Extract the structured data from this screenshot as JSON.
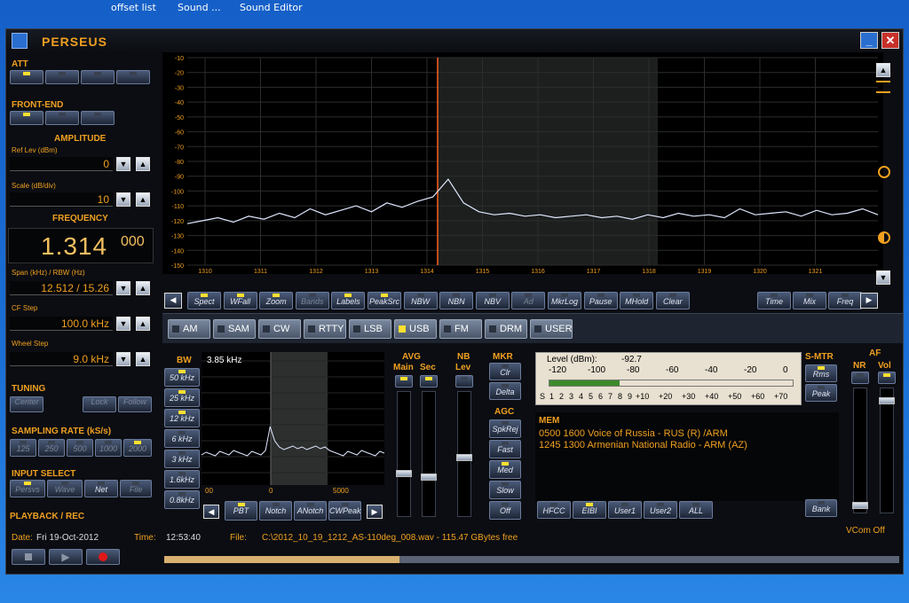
{
  "desktop": {
    "labels": [
      "offset list",
      "Sound ...",
      "Sound Editor"
    ]
  },
  "window": {
    "title": "PERSEUS",
    "minimize": "_",
    "close": "✕"
  },
  "left": {
    "att": "ATT",
    "frontend": "FRONT-END",
    "amplitude": "AMPLITUDE",
    "ref_lev_label": "Ref Lev (dBm)",
    "ref_lev": "0",
    "scale_label": "Scale (dB/div)",
    "scale": "10",
    "frequency": "FREQUENCY",
    "freq_main": "1.314",
    "freq_small": "000",
    "span_label": "Span (kHz) / RBW (Hz)",
    "span": "12.512 / 15.26",
    "cf_step_label": "CF Step",
    "cf_step": "100.0 kHz",
    "wheel_label": "Wheel Step",
    "wheel": "9.0 kHz",
    "tuning": "TUNING",
    "tuning_btns": [
      "Center",
      "Lock",
      "Follow"
    ],
    "sampling": "SAMPLING RATE (kS/s)",
    "sampling_btns": [
      "125",
      "250",
      "500",
      "1000",
      "2000"
    ],
    "input": "INPUT SELECT",
    "input_btns": [
      "Persvs",
      "Wave",
      "Net",
      "File"
    ],
    "playback": "PLAYBACK / REC"
  },
  "spectrum": {
    "y_ticks": [
      "-10",
      "-20",
      "-30",
      "-40",
      "-50",
      "-60",
      "-70",
      "-80",
      "-90",
      "-100",
      "-110",
      "-120",
      "-130",
      "-140",
      "-150"
    ],
    "x_ticks": [
      "1310",
      "1311",
      "1312",
      "1313",
      "1314",
      "1315",
      "1316",
      "1317",
      "1318",
      "1319",
      "1320",
      "1321"
    ],
    "trace": [
      -122,
      -120,
      -118,
      -121,
      -117,
      -119,
      -115,
      -118,
      -112,
      -116,
      -113,
      -110,
      -114,
      -108,
      -111,
      -107,
      -104,
      -92,
      -108,
      -114,
      -116,
      -115,
      -117,
      -116,
      -118,
      -117,
      -116,
      -118,
      -117,
      -119,
      -116,
      -118,
      -115,
      -117,
      -116,
      -118,
      -112,
      -116,
      -115,
      -114,
      -117,
      -113,
      -116,
      -115,
      -112,
      -116
    ],
    "buttons_top": [
      "Spect",
      "WFall",
      "Zoom",
      "Bands",
      "Labels",
      "PeakSrc",
      "NBW",
      "NBN",
      "NBV",
      "Ad",
      "MkrLog",
      "Pause",
      "MHold",
      "Clear"
    ],
    "buttons_right": [
      "Time",
      "Mix",
      "Freq"
    ]
  },
  "modes": [
    "AM",
    "SAM",
    "CW",
    "RTTY",
    "LSB",
    "USB",
    "FM",
    "DRM",
    "USER"
  ],
  "active_mode": "USB",
  "bw": {
    "title": "BW",
    "value": "3.85 kHz",
    "buttons": [
      "50 kHz",
      "25 kHz",
      "12 kHz",
      "6 kHz",
      "3 kHz",
      "1.6kHz",
      "0.8kHz"
    ],
    "x_ticks": [
      "00",
      "0",
      "5000"
    ],
    "bottom_btns": [
      "PBT",
      "Notch",
      "ANotch",
      "CWPeak"
    ]
  },
  "avg": {
    "title": "AVG",
    "main": "Main",
    "sec": "Sec"
  },
  "nb": {
    "title": "NB",
    "lev": "Lev"
  },
  "mkr": {
    "title": "MKR",
    "btns": [
      "Clr",
      "Delta"
    ]
  },
  "agc": {
    "title": "AGC",
    "btns": [
      "SpkRej",
      "Fast",
      "Med",
      "Slow",
      "Off"
    ]
  },
  "meter": {
    "level_label": "Level (dBm):",
    "level": "-92.7",
    "top_scale": [
      "-120",
      "-100",
      "-80",
      "-60",
      "-40",
      "-20",
      "0"
    ],
    "bottom_scale": [
      "S",
      "1",
      "2",
      "3",
      "4",
      "5",
      "6",
      "7",
      "8",
      "9",
      "+10",
      "+20",
      "+30",
      "+40",
      "+50",
      "+60",
      "+70"
    ]
  },
  "smtr": {
    "title": "S-MTR",
    "btns": [
      "Rms",
      "Peak"
    ]
  },
  "af": {
    "title": "AF",
    "nr": "NR",
    "vol": "Vol"
  },
  "mem": {
    "title": "MEM",
    "lines": [
      "0500 1600 Voice of Russia - RUS (R)  /ARM",
      "1245 1300 Armenian National Radio - ARM (AZ)"
    ],
    "btns": [
      "HFCC",
      "EIBI",
      "User1",
      "User2",
      "ALL"
    ],
    "bank": "Bank"
  },
  "statusbar": {
    "date_label": "Date:",
    "date": "Fri 19-Oct-2012",
    "time_label": "Time:",
    "time": "12:53:40",
    "file_label": "File:",
    "file": "C:\\2012_10_19_1212_AS-110deg_008.wav - 115.47 GBytes free",
    "vcom": "VCom Off"
  }
}
